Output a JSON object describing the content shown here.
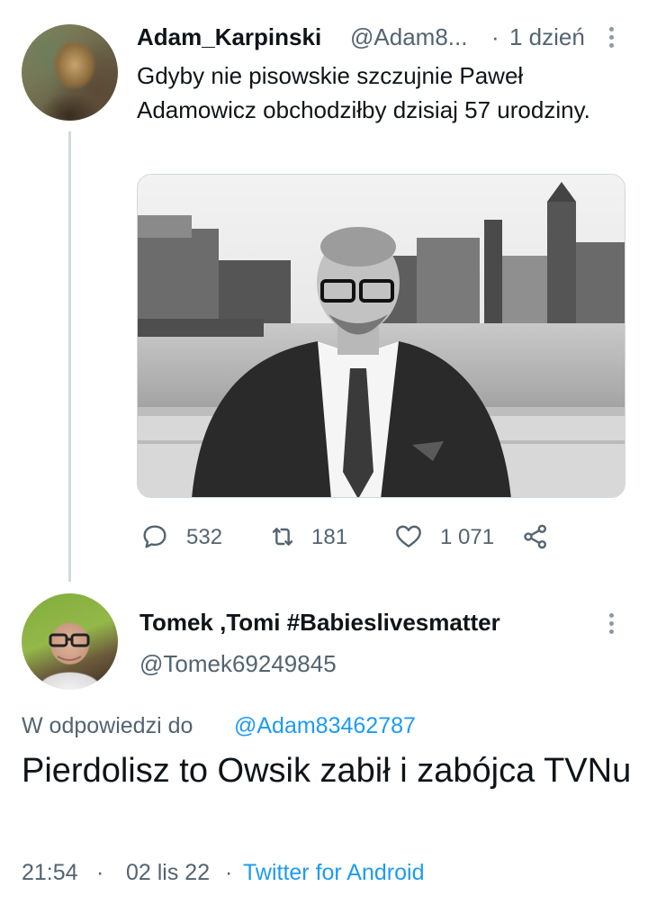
{
  "tweet": {
    "author_name": "Adam_Karpinski",
    "author_handle": "@Adam8...",
    "separator": "·",
    "time_ago": "1 dzień",
    "text": "Gdyby nie pisowskie szczujnie Paweł Adamowicz obchodziłby dzisiaj 57 urodziny.",
    "avatar": "user-avatar",
    "photo": "black-and-white portrait photo",
    "actions": {
      "reply_icon": "reply-icon",
      "reply_count": "532",
      "retweet_icon": "retweet-icon",
      "retweet_count": "181",
      "like_icon": "heart-icon",
      "like_count": "1 071",
      "share_icon": "share-icon"
    }
  },
  "reply": {
    "author_name": "Tomek ,Tomi #Babieslivesmatter",
    "author_handle": "@Tomek69249845",
    "reply_prefix": "W odpowiedzi do",
    "reply_to": "@Adam83462787",
    "text": "Pierdolisz to Owsik zabił i zabójca TVNu",
    "time": "21:54",
    "separator": "·",
    "date": "02 lis 22",
    "source": "Twitter for Android"
  },
  "colors": {
    "text": "#0f1419",
    "secondary": "#536471",
    "link": "#1d9bf0",
    "thread_line": "#cfd9de"
  }
}
